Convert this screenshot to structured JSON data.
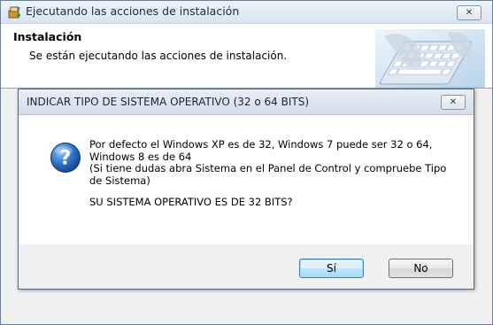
{
  "installer": {
    "title": "Ejecutando las acciones de instalación",
    "header_title": "Instalación",
    "header_subtitle": "Se están ejecutando las acciones de instalación.",
    "title_icon": "installer-package-icon",
    "header_image": "keyboard-image",
    "close_glyph": "✕"
  },
  "dialog": {
    "title": "INDICAR TIPO DE SISTEMA OPERATIVO (32 o 64 BITS)",
    "close_glyph": "✕",
    "icon": "question-icon",
    "icon_glyph": "?",
    "message_line1": "Por defecto el Windows XP es de 32, Windows 7 puede ser 32 o 64, Windows 8 es de 64",
    "message_line2": "(Si tiene dudas abra Sistema en el Panel de Control y compruebe Tipo de Sistema)",
    "question": "SU SISTEMA OPERATIVO ES DE 32 BITS?",
    "yes_label": "Sí",
    "no_label": "No"
  },
  "colors": {
    "question_icon": "#1f5fb5",
    "default_button_border": "#3c7fb1"
  }
}
